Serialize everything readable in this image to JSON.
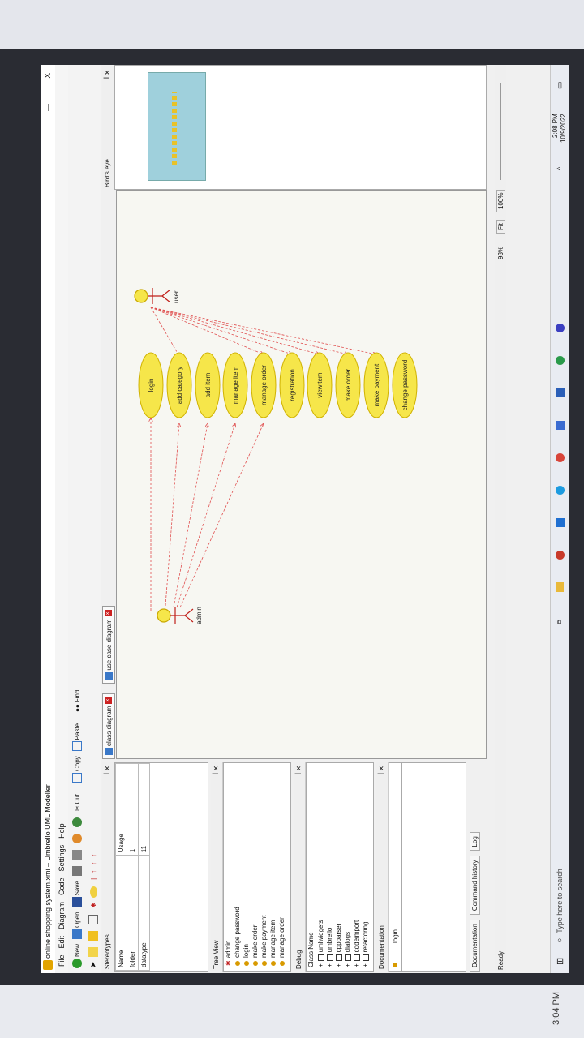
{
  "window": {
    "title": "online shopping system.xmi – Umbrello UML Modeller",
    "close": "X",
    "min": "—"
  },
  "menu": [
    "File",
    "Edit",
    "Diagram",
    "Code",
    "Settings",
    "Help"
  ],
  "toolbar": {
    "new": "New",
    "open": "Open",
    "save": "Save",
    "cut": "Cut",
    "copy": "Copy",
    "paste": "Paste",
    "find": "Find"
  },
  "stereotypes": {
    "title": "Stereotypes",
    "headers": [
      "Name",
      "Usage"
    ],
    "rows": [
      [
        "folder",
        "1"
      ],
      [
        "datatype",
        "11"
      ]
    ]
  },
  "tree_view": {
    "title": "Tree View",
    "items": [
      "admin",
      "change password",
      "login",
      "make order",
      "make payment",
      "manage item",
      "manage order"
    ]
  },
  "debug": {
    "title": "Debug",
    "header": "Class Name",
    "items": [
      "umlwidgets",
      "umbrello",
      "cppparser",
      "dialogs",
      "codeimport",
      "refactoring"
    ]
  },
  "documentation": {
    "title": "Documentation",
    "value": "login"
  },
  "bottom_tabs": [
    "Documentation",
    "Command history",
    "Log"
  ],
  "status": {
    "ready": "Ready",
    "zoom": "93%",
    "fit": "Fit",
    "zoom100": "100%"
  },
  "diagram_tabs": [
    "class diagram",
    "use case diagram"
  ],
  "birds_eye": "Bird's eye",
  "diagram": {
    "actors": [
      "admin",
      "user"
    ],
    "use_cases": [
      "login",
      "add category",
      "add item",
      "manage item",
      "manage order",
      "registration",
      "viewitem",
      "make order",
      "make payment",
      "change password"
    ]
  },
  "taskbar": {
    "search": "Type here to search",
    "time": "2:08 PM",
    "date": "10/9/2022"
  },
  "phone": {
    "time": "3:04 PM"
  }
}
